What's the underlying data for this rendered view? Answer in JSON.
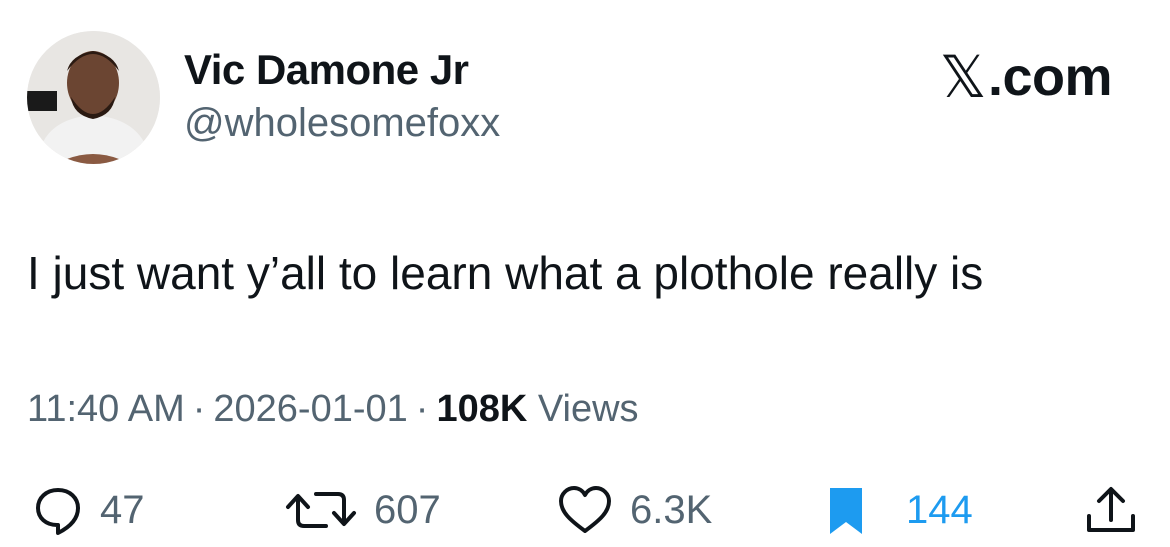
{
  "author": {
    "name": "Vic Damone Jr",
    "handle": "@wholesomefoxx"
  },
  "brand": {
    "mark": "𝕏",
    "suffix": ".com"
  },
  "tweet": {
    "text": "I just want y’all to learn what a plothole really is"
  },
  "meta": {
    "time": "11:40 AM",
    "separator": "·",
    "date": "2026-01-01",
    "views_count": "108K",
    "views_label": "Views"
  },
  "actions": {
    "replies": "47",
    "reposts": "607",
    "likes": "6.3K",
    "bookmarks": "144"
  },
  "icons": {
    "reply": "reply-bubble-icon",
    "repost": "repost-arrows-icon",
    "like": "heart-icon",
    "bookmark": "bookmark-icon",
    "share": "share-upload-icon"
  },
  "colors": {
    "text": "#0f1419",
    "secondary": "#536471",
    "accent": "#1d9bf0"
  }
}
